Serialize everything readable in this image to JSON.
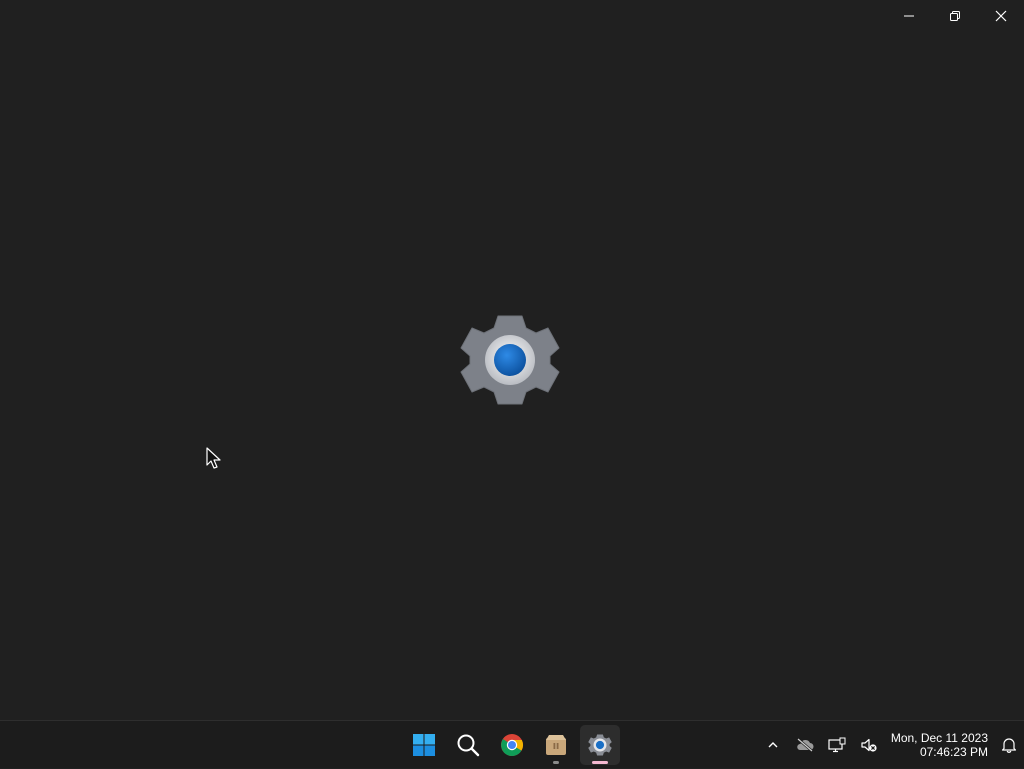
{
  "window": {
    "controls": {
      "minimize": "minimize-icon",
      "restore": "restore-icon",
      "close": "close-icon"
    },
    "splash_icon": "settings-gear-icon",
    "colors": {
      "background": "#202020",
      "gear": "#7d8189",
      "accent": "#0f6cbd"
    }
  },
  "taskbar": {
    "apps": [
      {
        "name": "Start",
        "icon": "windows-logo-icon"
      },
      {
        "name": "Search",
        "icon": "search-icon"
      },
      {
        "name": "Google Chrome",
        "icon": "chrome-icon"
      },
      {
        "name": "Package",
        "icon": "package-icon"
      },
      {
        "name": "Settings",
        "icon": "settings-gear-icon",
        "active": true
      }
    ],
    "tray": {
      "icons": [
        "chevron-up-icon",
        "cloud-offline-icon",
        "network-icon",
        "volume-muted-icon"
      ]
    },
    "clock": {
      "date": "Mon, Dec 11 2023",
      "time": "07:46:23 PM"
    },
    "notifications_icon": "bell-icon"
  }
}
